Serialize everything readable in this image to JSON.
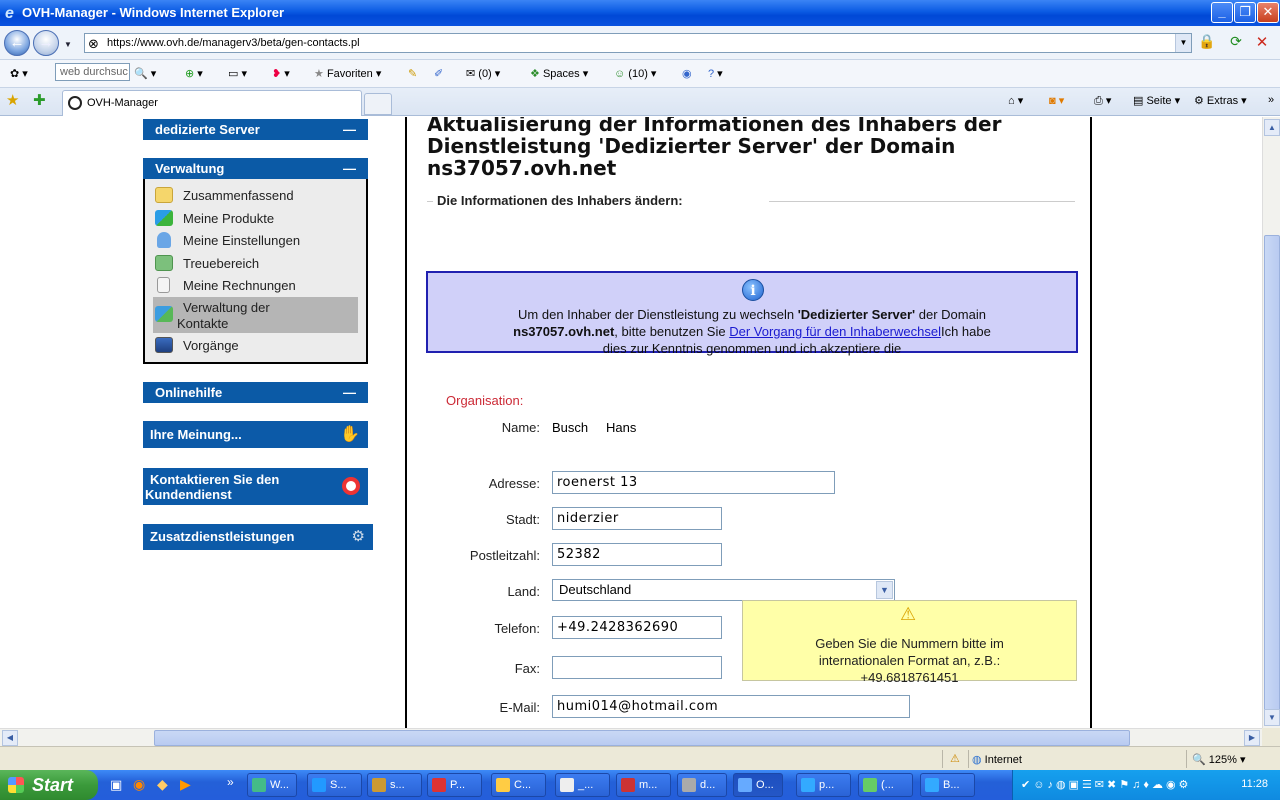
{
  "window": {
    "title": "OVH-Manager - Windows Internet Explorer"
  },
  "address": {
    "url": "https://www.ovh.de/managerv3/beta/gen-contacts.pl"
  },
  "toolbar": {
    "search_placeholder": "web durchsuc",
    "favorites": "Favoriten",
    "mail_count": "(0)",
    "spaces": "Spaces",
    "contacts_count": "(10)"
  },
  "tabs": {
    "active_label": "OVH-Manager",
    "page_label": "Seite",
    "extras_label": "Extras"
  },
  "sidebar": {
    "top_section": "dedizierte Server",
    "verwaltung": {
      "title": "Verwaltung",
      "items": [
        {
          "label": "Zusammenfassend",
          "icon": "folder-icon"
        },
        {
          "label": "Meine Produkte",
          "icon": "products-icon"
        },
        {
          "label": "Meine Einstellungen",
          "icon": "user-settings-icon"
        },
        {
          "label": "Treuebereich",
          "icon": "money-icon"
        },
        {
          "label": "Meine Rechnungen",
          "icon": "invoice-icon"
        },
        {
          "label": "Verwaltung der",
          "label2": "Kontakte",
          "icon": "contacts-icon"
        },
        {
          "label": "Vorgänge",
          "icon": "tasks-icon"
        }
      ]
    },
    "onlinehilfe": "Onlinehilfe",
    "meinung": "Ihre Meinung...",
    "kontakt_line1": "Kontaktieren Sie den",
    "kontakt_line2": "Kundendienst",
    "zusatz": "Zusatzdienstleistungen"
  },
  "main": {
    "title_line1": "Aktualisierung der Informationen des Inhabers der",
    "title_line2": "Dienstleistung 'Dedizierter Server' der Domain",
    "title_line3": "ns37057.ovh.net",
    "legend": "Die Informationen des Inhabers ändern:",
    "info": {
      "text1": "Um den Inhaber der Dienstleistung zu wechseln ",
      "text_bold1": "'Dedizierter Server'",
      "text2": " der Domain",
      "text_bold2": "ns37057.ovh.net",
      "text3": ", bitte benutzen Sie ",
      "link": "Der Vorgang für den Inhaberwechsel",
      "text4": "Ich habe",
      "text5": "dies zur Kenntnis genommen und ich akzeptiere die"
    },
    "form": {
      "section": "Organisation:",
      "name_label": "Name:",
      "name_last": "Busch",
      "name_first": "Hans",
      "address_label": "Adresse:",
      "address_value": "roenerst 13",
      "city_label": "Stadt:",
      "city_value": "niderzier",
      "zip_label": "Postleitzahl:",
      "zip_value": "52382",
      "country_label": "Land:",
      "country_value": "Deutschland",
      "phone_label": "Telefon:",
      "phone_value": "+49.2428362690",
      "fax_label": "Fax:",
      "fax_value": "",
      "email_label": "E-Mail:",
      "email_value": "humi014@hotmail.com"
    },
    "warning": {
      "line1": "Geben Sie die Nummern bitte im",
      "line2": "internationalen Format an, z.B.:",
      "line3": "+49.6818761451"
    }
  },
  "status": {
    "zone": "Internet",
    "zoom": "125%"
  },
  "taskbar": {
    "start": "Start",
    "tasks": [
      "W...",
      "S...",
      "s...",
      "P...",
      "C...",
      "_...",
      "m...",
      "d...",
      "O...",
      "p...",
      "(...",
      "B..."
    ],
    "clock": "11:28"
  }
}
